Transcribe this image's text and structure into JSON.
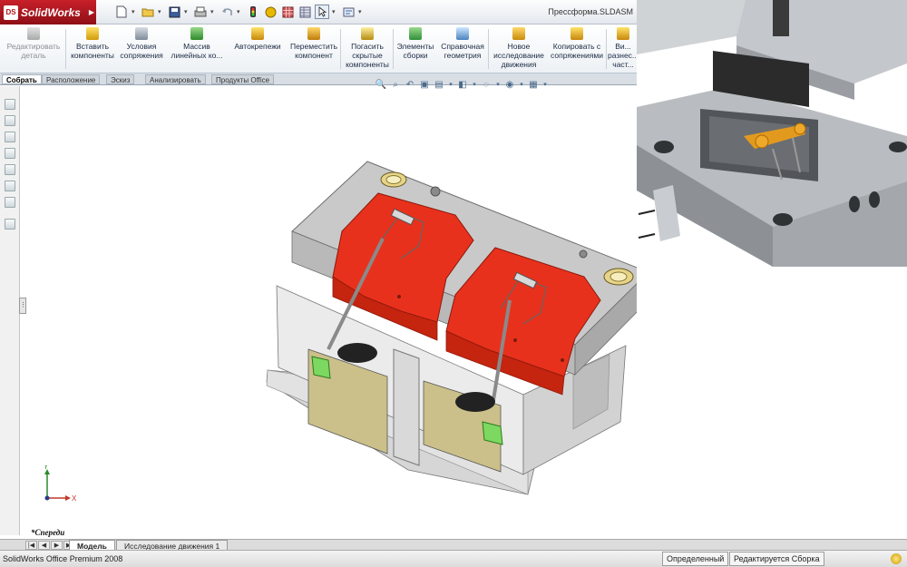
{
  "app": {
    "brand": "SolidWorks",
    "logo_badge": "DS",
    "document_title": "Прессформа.SLDASM"
  },
  "quickbar": {
    "icons": [
      "new-icon",
      "open-icon",
      "save-icon",
      "print-icon",
      "undo-icon",
      "traffic-light-icon",
      "yellow-ball-icon",
      "grid-icon",
      "table-icon",
      "select-cursor-icon",
      "options-icon"
    ]
  },
  "commands": [
    {
      "label": "Редактировать деталь",
      "disabled": true
    },
    {
      "label": "Вставить компоненты"
    },
    {
      "label": "Условия сопряжения"
    },
    {
      "label": "Массив линейных ко..."
    },
    {
      "label": "Автокрепежи"
    },
    {
      "label": "Переместить компонент"
    },
    {
      "label": "Погасить скрытые компоненты"
    },
    {
      "label": "Элементы сборки"
    },
    {
      "label": "Справочная геометрия"
    },
    {
      "label": "Новое исследование движения"
    },
    {
      "label": "Копировать с сопряжениями"
    },
    {
      "label": "Ви... разнес... част..."
    }
  ],
  "tabs": [
    "Собрать",
    "Расположение",
    "Эскиз",
    "Анализировать",
    "Продукты Office"
  ],
  "view_label": "*Спереди",
  "triad": {
    "x": "X",
    "y": "Y"
  },
  "model_tabs": [
    "Модель",
    "Исследование движения 1"
  ],
  "status": {
    "product": "SolidWorks Office Premium 2008",
    "state": "Определенный",
    "mode": "Редактируется Сборка"
  },
  "colors": {
    "accent_red": "#e8311c",
    "brand_red": "#b3141c",
    "mould_grey": "#c8c8c8",
    "bushing_yellow": "#d8c67a",
    "slider_green": "#7cd860"
  }
}
